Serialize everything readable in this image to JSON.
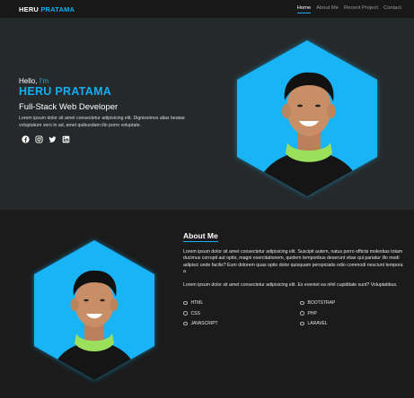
{
  "navbar": {
    "brand_first": "HERU",
    "brand_second": "PRATAMA",
    "links": [
      {
        "label": "Home",
        "active": true
      },
      {
        "label": "About Me",
        "active": false
      },
      {
        "label": "Recent Project",
        "active": false
      },
      {
        "label": "Contact",
        "active": false
      }
    ]
  },
  "hero": {
    "greeting": "Hello,",
    "greeting_accent": "I'm",
    "name": "HERU PRATAMA",
    "role": "Full-Stack Web Developer",
    "description": "Lorem ipsum dolor sit amet consectetur adipisicing elit. Dignissimos alias beatae voluptatum vero in ad, amet quibusdam illo porro voluptate.",
    "socials": [
      {
        "icon": "facebook-icon"
      },
      {
        "icon": "instagram-icon"
      },
      {
        "icon": "twitter-icon"
      },
      {
        "icon": "linkedin-icon"
      }
    ]
  },
  "about": {
    "title": "About Me",
    "paragraph1": "Lorem ipsum dolor sit amet consectetur adipisicing elit. Suscipit autem, natus porro officiis molestias totam ducimus corrupti aut optio, magni exercitationem, quidem temporibus deserunt vitae qui pariatur illo modi adipisci unde facilis? Eum dolorem quas optio dolor quisquam perspiciatis odio commodi nesciunt tempora a",
    "paragraph2": "Lorem ipsum dolor sit amet consectetur adipisicing elit. Ex eveniet ea nihil cupiditate sunt? Voluptatibus.",
    "skills": [
      "HTML",
      "BOOTSTRAP",
      "CSS",
      "PHP",
      "JAVASCRIPT",
      "LARAVEL"
    ]
  },
  "colors": {
    "accent": "#15aef0",
    "hero_bg": "#26292a",
    "about_bg": "#1b1b1b",
    "navbar_bg": "#181818"
  }
}
